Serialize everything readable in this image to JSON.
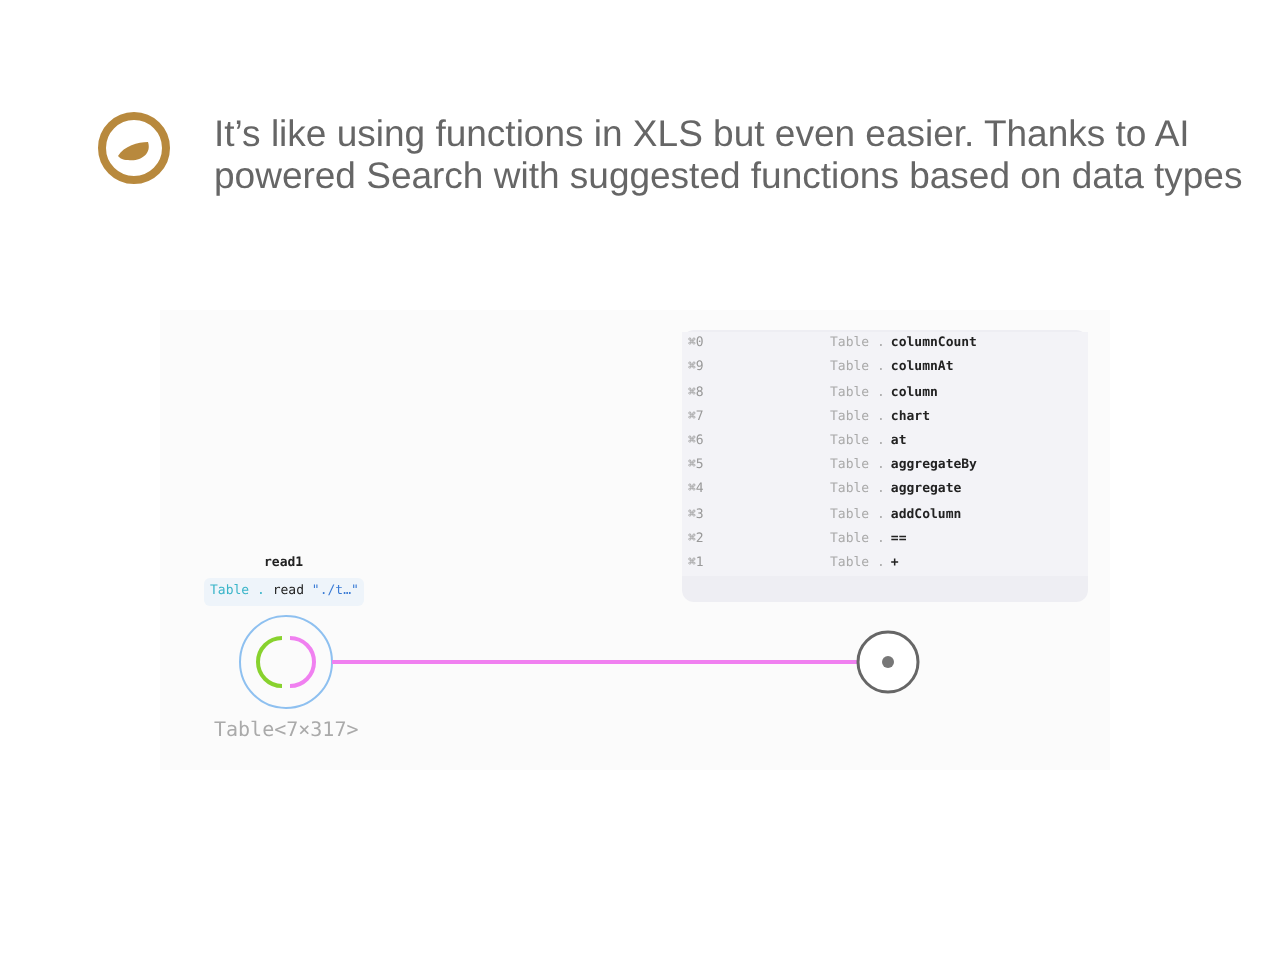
{
  "caption": {
    "lines": [
      "It’s like using functions in XLS but even easier. Thanks to AI",
      "powered Search with suggested functions based on data types"
    ]
  },
  "menu": {
    "items": [
      {
        "shortcut": "⌘0",
        "type": "Table",
        "separator": ".",
        "method": "columnCount"
      },
      {
        "shortcut": "⌘9",
        "type": "Table",
        "separator": ".",
        "method": "columnAt"
      },
      {
        "shortcut": "⌘8",
        "type": "Table",
        "separator": ".",
        "method": "column"
      },
      {
        "shortcut": "⌘7",
        "type": "Table",
        "separator": ".",
        "method": "chart"
      },
      {
        "shortcut": "⌘6",
        "type": "Table",
        "separator": ".",
        "method": "at"
      },
      {
        "shortcut": "⌘5",
        "type": "Table",
        "separator": ".",
        "method": "aggregateBy"
      },
      {
        "shortcut": "⌘4",
        "type": "Table",
        "separator": ".",
        "method": "aggregate"
      },
      {
        "shortcut": "⌘3",
        "type": "Table",
        "separator": ".",
        "method": "addColumn"
      },
      {
        "shortcut": "⌘2",
        "type": "Table",
        "separator": ".",
        "method": "=="
      },
      {
        "shortcut": "⌘1",
        "type": "Table",
        "separator": ".",
        "method": "+"
      }
    ]
  },
  "node": {
    "name": "read1",
    "expression": {
      "type": "Table",
      "separator": ".",
      "method": "read",
      "argument": "\"./t…\""
    },
    "output_type": "Table<7×317>"
  }
}
